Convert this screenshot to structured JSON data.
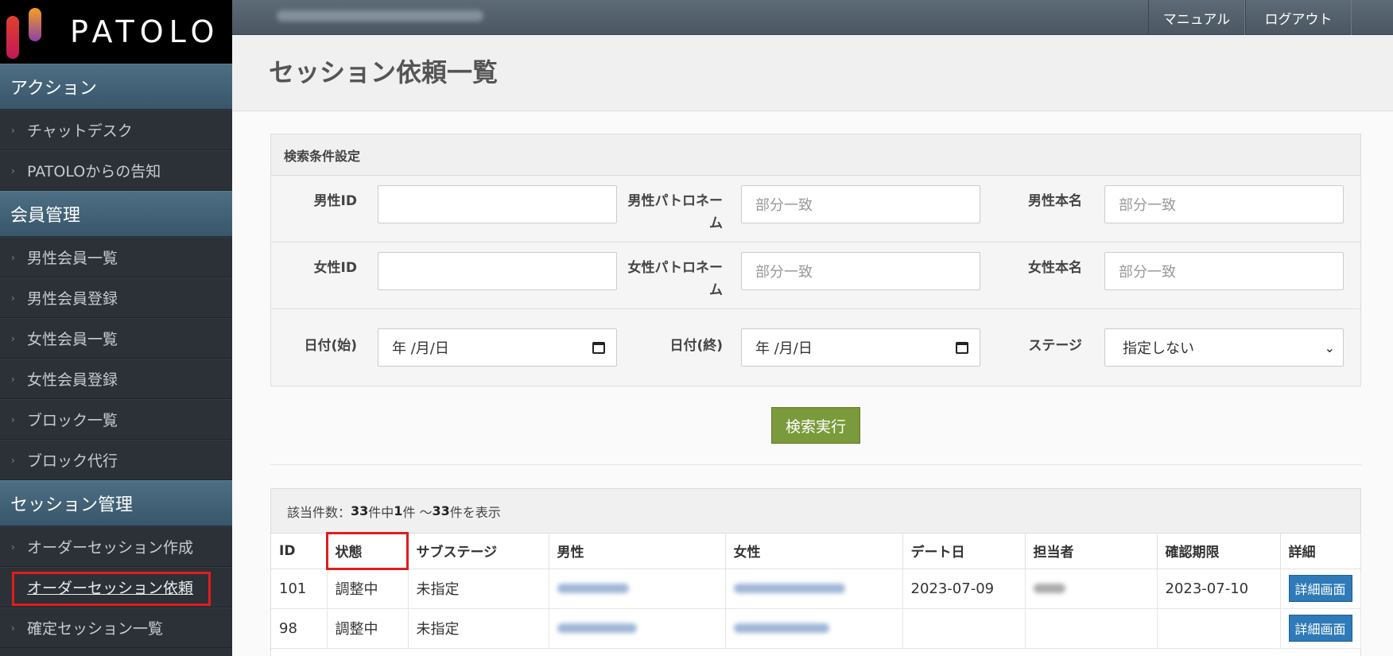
{
  "app": {
    "logo_text": "PATOLO"
  },
  "topbar": {
    "manual_label": "マニュアル",
    "logout_label": "ログアウト"
  },
  "sidebar": {
    "sections": [
      {
        "title": "アクション",
        "items": [
          "チャットデスク",
          "PATOLOからの告知"
        ]
      },
      {
        "title": "会員管理",
        "items": [
          "男性会員一覧",
          "男性会員登録",
          "女性会員一覧",
          "女性会員登録",
          "ブロック一覧",
          "ブロック代行"
        ]
      },
      {
        "title": "セッション管理",
        "items": [
          "オーダーセッション作成",
          "オーダーセッション依頼",
          "確定セッション一覧"
        ]
      }
    ],
    "active_item": "オーダーセッション依頼"
  },
  "page": {
    "title": "セッション依頼一覧"
  },
  "search": {
    "panel_title": "検索条件設定",
    "male_id_label": "男性ID",
    "male_patron_label": "男性パトロネーム",
    "male_real_label": "男性本名",
    "female_id_label": "女性ID",
    "female_patron_label": "女性パトロネーム",
    "female_real_label": "女性本名",
    "date_start_label": "日付(始)",
    "date_end_label": "日付(終)",
    "stage_label": "ステージ",
    "partial_placeholder": "部分一致",
    "date_placeholder": "年 /月/日",
    "stage_value": "指定しない",
    "submit_label": "検索実行"
  },
  "results": {
    "count_prefix": "該当件数：",
    "total": "33",
    "count_mid1": "件中 ",
    "from": "1",
    "count_mid2": "件 〜 ",
    "to": "33",
    "count_suffix": "件を表示",
    "columns": [
      "ID",
      "状態",
      "サブステージ",
      "男性",
      "女性",
      "デート日",
      "担当者",
      "確認期限",
      "詳細"
    ],
    "rows": [
      {
        "id": "101",
        "status": "調整中",
        "substage": "未指定",
        "date": "2023-07-09",
        "deadline": "2023-07-10",
        "detail": "詳細画面"
      },
      {
        "id": "98",
        "status": "調整中",
        "substage": "未指定",
        "date": "",
        "deadline": "",
        "detail": "詳細画面"
      }
    ]
  }
}
